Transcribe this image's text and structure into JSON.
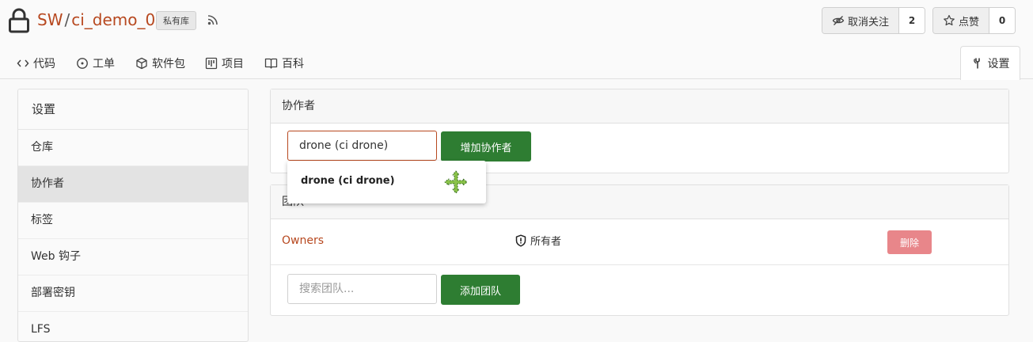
{
  "repo": {
    "owner": "SW",
    "separator": "/",
    "name": "ci_demo_0",
    "private_badge": "私有库"
  },
  "actions": {
    "watch_label": "取消关注",
    "watch_count": "2",
    "star_label": "点赞",
    "star_count": "0"
  },
  "tabs": [
    {
      "label": "代码",
      "icon": "code-icon"
    },
    {
      "label": "工单",
      "icon": "issue-icon"
    },
    {
      "label": "软件包",
      "icon": "package-icon"
    },
    {
      "label": "项目",
      "icon": "project-icon"
    },
    {
      "label": "百科",
      "icon": "book-icon"
    },
    {
      "label": "设置",
      "icon": "tools-icon",
      "active": true
    }
  ],
  "sidebar": {
    "header": "设置",
    "items": [
      {
        "label": "仓库"
      },
      {
        "label": "协作者",
        "active": true
      },
      {
        "label": "标签"
      },
      {
        "label": "Web 钩子"
      },
      {
        "label": "部署密钥"
      },
      {
        "label": "LFS"
      }
    ]
  },
  "collaborators": {
    "title": "协作者",
    "input_value": "drone (ci drone)",
    "add_button": "增加协作者",
    "dropdown_item": "drone (ci drone)"
  },
  "teams": {
    "title": "团队",
    "row": {
      "name": "Owners",
      "role": "所有者",
      "delete_button": "删除"
    },
    "search_placeholder": "搜索团队...",
    "add_button": "添加团队"
  },
  "colors": {
    "accent": "#b7481f",
    "primary_button": "#2e7d32",
    "danger_button": "#e8868a"
  }
}
